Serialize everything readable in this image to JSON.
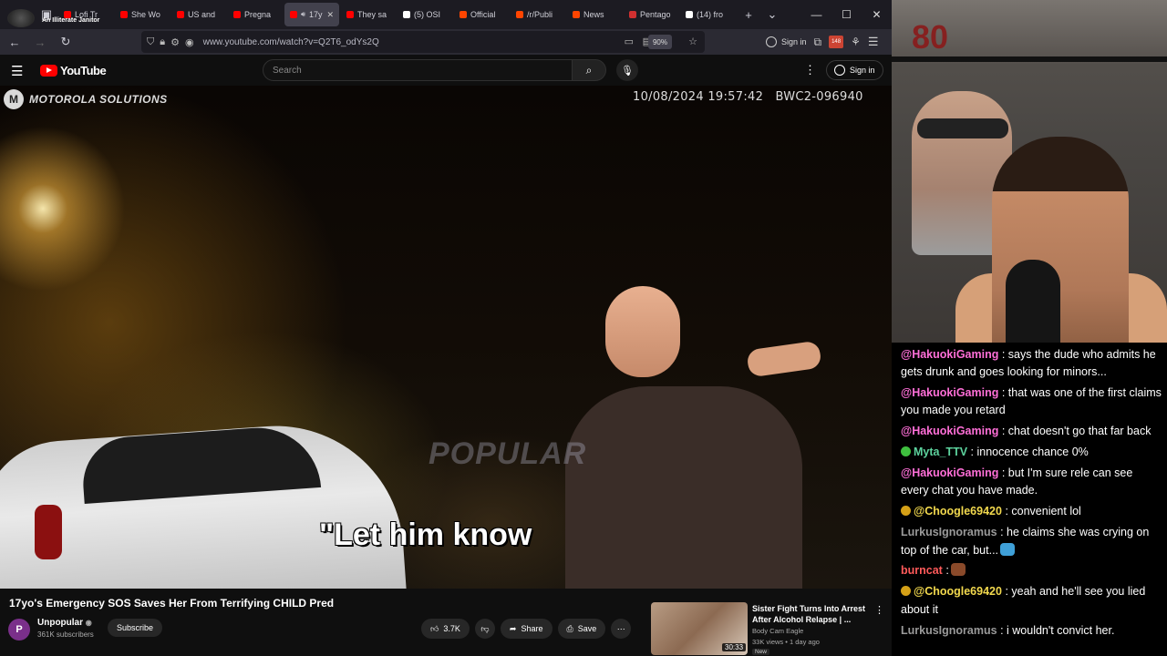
{
  "browser": {
    "profile_label": "An Illiterate Janitor",
    "tabs": [
      {
        "label": "Lofi Tr",
        "color": "#ff0000"
      },
      {
        "label": "She Wo",
        "color": "#ff0000"
      },
      {
        "label": "US and",
        "color": "#ff0000"
      },
      {
        "label": "Pregna",
        "color": "#ff0000"
      },
      {
        "label": "17y",
        "color": "#ff0000",
        "active": true
      },
      {
        "label": "They sa",
        "color": "#ff0000"
      },
      {
        "label": "(5) OSI",
        "color": "#ffffff"
      },
      {
        "label": "Official",
        "color": "#ff4500"
      },
      {
        "label": "/r/Publi",
        "color": "#ff4500"
      },
      {
        "label": "News",
        "color": "#ff4500"
      },
      {
        "label": "Pentago",
        "color": "#d03030"
      },
      {
        "label": "(14) fro",
        "color": "#ffffff"
      }
    ],
    "url": "www.youtube.com/watch?v=Q2T6_odYs2Q",
    "zoom": "90%",
    "signin_label": "Sign in",
    "extension_count": "148"
  },
  "youtube": {
    "logo_text": "YouTube",
    "search_placeholder": "Search",
    "signin_label": "Sign in"
  },
  "video": {
    "brand": "MOTOROLA SOLUTIONS",
    "brand_mark": "M",
    "camera_stamp": "10/08/2024 19:57:42   BWC2-096940",
    "watermark": "POPULAR",
    "caption": "\"Let him know"
  },
  "meta": {
    "title": "17yo's Emergency SOS Saves Her From Terrifying CHILD Pred",
    "channel_initial": "P",
    "channel_name": "Unpopular",
    "subscribers": "361K subscribers",
    "subscribe_label": "Subscribe",
    "likes": "3.7K",
    "share_label": "Share",
    "save_label": "Save"
  },
  "recommendation": {
    "title": "Sister Fight Turns Into Arrest After Alcohol Relapse | ...",
    "channel": "Body Cam Eagle",
    "meta": "33K views • 1 day ago",
    "badge": "New",
    "duration": "30:33"
  },
  "stream": {
    "logo_text": "80"
  },
  "chat": [
    {
      "user": "@HakuokiGaming",
      "color": "#ff6fd8",
      "badge": "",
      "text": ": says the dude who admits he gets drunk and goes looking for minors..."
    },
    {
      "user": "@HakuokiGaming",
      "color": "#ff6fd8",
      "badge": "",
      "text": ": that was one of the first claims you made you retard"
    },
    {
      "user": "@HakuokiGaming",
      "color": "#ff6fd8",
      "badge": "",
      "text": ": chat doesn't go that far back"
    },
    {
      "user": "Myta_TTV",
      "color": "#5dd39e",
      "badge": "#3fbf3f",
      "text": ": innocence chance 0%"
    },
    {
      "user": "@HakuokiGaming",
      "color": "#ff6fd8",
      "badge": "",
      "text": ": but I'm sure rele can see every chat you have made."
    },
    {
      "user": "@Choogle69420",
      "color": "#f2d94e",
      "badge": "#d4a017",
      "text": ": convenient lol"
    },
    {
      "user": "LurkusIgnoramus",
      "color": "#9a9a9a",
      "badge": "",
      "text": ": he claims she was crying on top of the car, but...",
      "emote": "#3fa0d8"
    },
    {
      "user": "burncat",
      "color": "#ff5a5a",
      "badge": "",
      "text": ":",
      "emote": "#8a4a2a"
    },
    {
      "user": "@Choogle69420",
      "color": "#f2d94e",
      "badge": "#d4a017",
      "text": ": yeah and he'll see you lied about it"
    },
    {
      "user": "LurkusIgnoramus",
      "color": "#9a9a9a",
      "badge": "",
      "text": ": i wouldn't convict her."
    }
  ]
}
